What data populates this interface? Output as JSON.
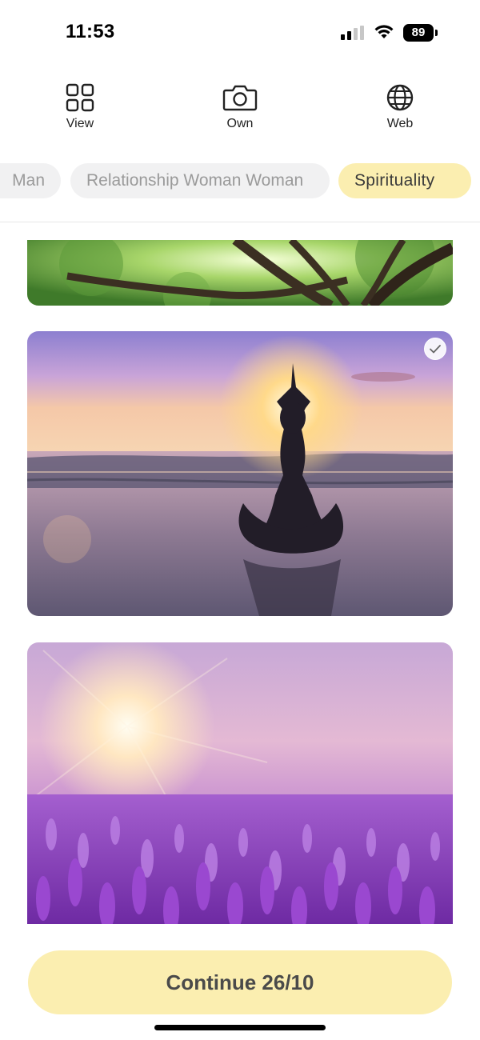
{
  "status_bar": {
    "time": "11:53",
    "battery": "89"
  },
  "top_actions": [
    {
      "label": "View",
      "icon": "grid-icon"
    },
    {
      "label": "Own",
      "icon": "camera-icon"
    },
    {
      "label": "Web",
      "icon": "globe-icon"
    }
  ],
  "categories": [
    {
      "label": "Man",
      "selected": false
    },
    {
      "label": "Relationship Woman Woman",
      "selected": false
    },
    {
      "label": "Spirituality",
      "selected": true
    }
  ],
  "images": [
    {
      "subject": "tree canopy",
      "selected": false
    },
    {
      "subject": "yoga at sunset on beach",
      "selected": true
    },
    {
      "subject": "lavender field with sun",
      "selected": false
    }
  ],
  "continue_label": "Continue 26/10",
  "colors": {
    "accent": "#fbeeb0",
    "chip_bg": "#f1f1f2",
    "chip_text": "#9a9a9a"
  }
}
